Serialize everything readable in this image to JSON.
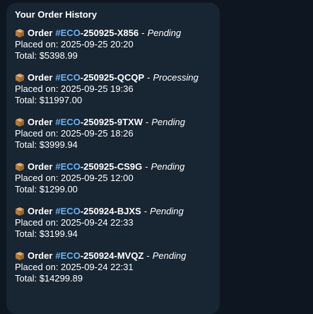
{
  "panel": {
    "title": "Your Order History"
  },
  "labels": {
    "order_word": "Order",
    "placed_prefix": "Placed on: ",
    "total_prefix": "Total: ",
    "separator": "-"
  },
  "orders": [
    {
      "hashtag": "#ECO",
      "code": "-250925-X856",
      "status": "Pending",
      "placed_on": "2025-09-25 20:20",
      "total": "$5398.99"
    },
    {
      "hashtag": "#ECO",
      "code": "-250925-QCQP",
      "status": "Processing",
      "placed_on": "2025-09-25 19:36",
      "total": "$11997.00"
    },
    {
      "hashtag": "#ECO",
      "code": "-250925-9TXW",
      "status": "Pending",
      "placed_on": "2025-09-25 18:26",
      "total": "$3999.94"
    },
    {
      "hashtag": "#ECO",
      "code": "-250925-CS9G",
      "status": "Pending",
      "placed_on": "2025-09-25 12:00",
      "total": "$1299.00"
    },
    {
      "hashtag": "#ECO",
      "code": "-250924-BJXS",
      "status": "Pending",
      "placed_on": "2025-09-24 22:33",
      "total": "$3199.94"
    },
    {
      "hashtag": "#ECO",
      "code": "-250924-MVQZ",
      "status": "Pending",
      "placed_on": "2025-09-24 22:31",
      "total": "$14299.89"
    }
  ],
  "icons": {
    "order": "package-icon"
  },
  "colors": {
    "background": "#0e1621",
    "bubble": "#182533",
    "hashtag": "#6ab3f3",
    "text": "#ffffff"
  }
}
